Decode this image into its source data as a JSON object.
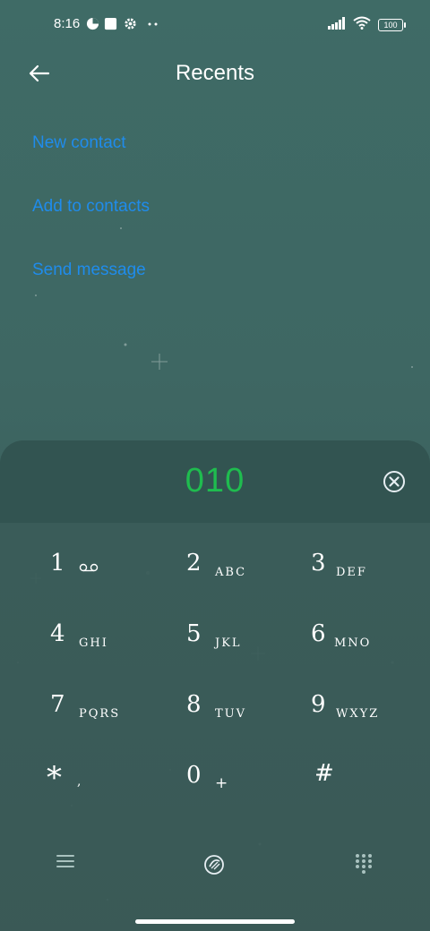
{
  "status": {
    "time": "8:16",
    "battery": "100"
  },
  "header": {
    "title": "Recents"
  },
  "actions": [
    {
      "label": "New contact"
    },
    {
      "label": "Add to contacts"
    },
    {
      "label": "Send message"
    }
  ],
  "dialer": {
    "number": "010",
    "keys": [
      {
        "digit": "1",
        "letters": ""
      },
      {
        "digit": "2",
        "letters": "ABC"
      },
      {
        "digit": "3",
        "letters": "DEF"
      },
      {
        "digit": "4",
        "letters": "GHI"
      },
      {
        "digit": "5",
        "letters": "JKL"
      },
      {
        "digit": "6",
        "letters": "MNO"
      },
      {
        "digit": "7",
        "letters": "PQRS"
      },
      {
        "digit": "8",
        "letters": "TUV"
      },
      {
        "digit": "9",
        "letters": "WXYZ"
      },
      {
        "digit": "*",
        "letters": ","
      },
      {
        "digit": "0",
        "letters": "+"
      },
      {
        "digit": "#",
        "letters": ""
      }
    ]
  },
  "colors": {
    "accent_link": "#1f8cec",
    "number_green": "#1fbc4f"
  },
  "icons": {
    "back": "arrow-left-icon",
    "clear": "backspace-x-icon",
    "voicemail": "voicemail-icon",
    "menu": "menu-icon",
    "call": "call-icon",
    "dialpad": "dialpad-icon"
  }
}
